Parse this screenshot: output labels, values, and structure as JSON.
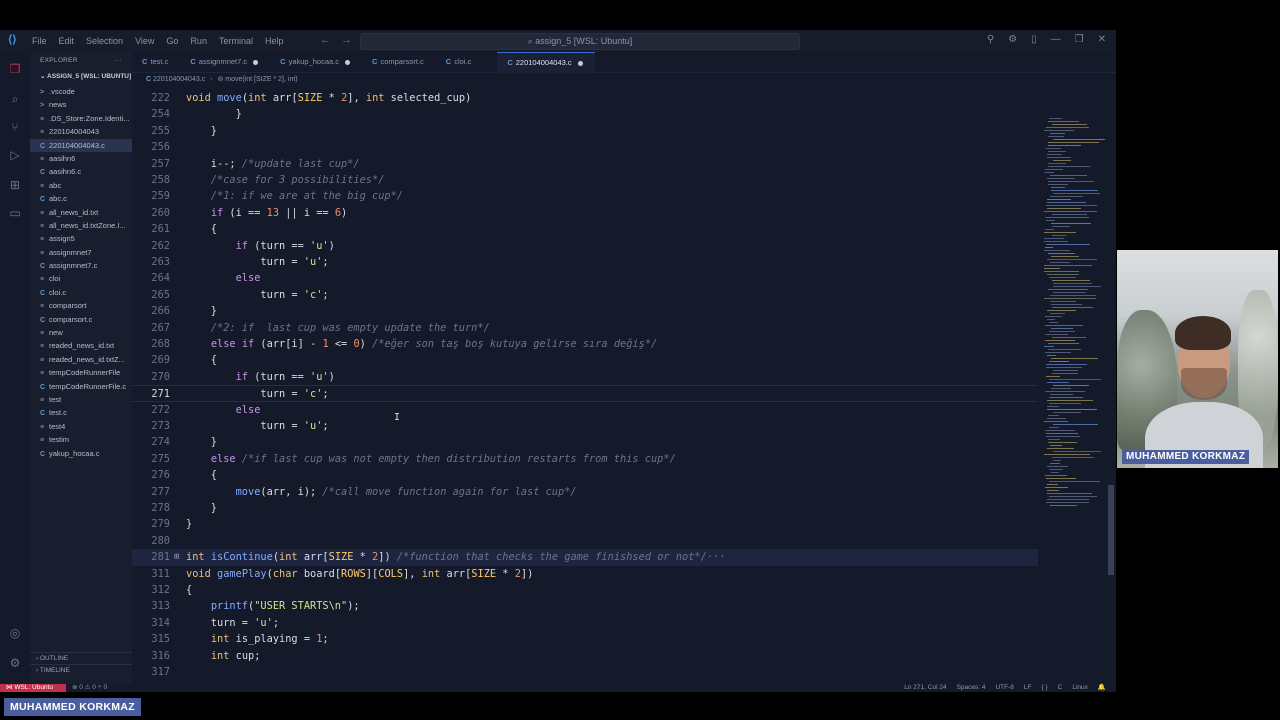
{
  "titlebar": {
    "menu": [
      "File",
      "Edit",
      "Selection",
      "View",
      "Go",
      "Run",
      "Terminal",
      "Help"
    ],
    "search": "assign_5 [WSL: Ubuntu]"
  },
  "sidebar": {
    "header": "EXPLORER",
    "header_more": "···",
    "folder": "ASSIGN_5 [WSL: UBUNTU]",
    "items": [
      {
        "label": ".vscode",
        "icon": ">"
      },
      {
        "label": "news",
        "icon": ">"
      },
      {
        "label": ".DS_Store:Zone.Identi...",
        "icon": "≡"
      },
      {
        "label": "220104004043",
        "icon": "≡"
      },
      {
        "label": "220104004043.c",
        "icon": "C"
      },
      {
        "label": "aasihn6",
        "icon": "≡"
      },
      {
        "label": "aasihn6.c",
        "icon": "C"
      },
      {
        "label": "abc",
        "icon": "≡"
      },
      {
        "label": "abc.c",
        "icon": "C"
      },
      {
        "label": "all_news_id.txt",
        "icon": "≡"
      },
      {
        "label": "all_news_id.txtZone.I...",
        "icon": "≡"
      },
      {
        "label": "assign5",
        "icon": "≡"
      },
      {
        "label": "assignmnet7",
        "icon": "≡"
      },
      {
        "label": "assignmnet7.c",
        "icon": "C"
      },
      {
        "label": "cloi",
        "icon": "≡"
      },
      {
        "label": "cloi.c",
        "icon": "C"
      },
      {
        "label": "comparsort",
        "icon": "≡"
      },
      {
        "label": "comparsort.c",
        "icon": "C"
      },
      {
        "label": "new",
        "icon": "≡"
      },
      {
        "label": "readed_news_id.txt",
        "icon": "≡"
      },
      {
        "label": "readed_news_id.txtZ...",
        "icon": "≡"
      },
      {
        "label": "tempCodeRunnerFile",
        "icon": "≡"
      },
      {
        "label": "tempCodeRunnerFile.c",
        "icon": "C"
      },
      {
        "label": "test",
        "icon": "≡"
      },
      {
        "label": "test.c",
        "icon": "C"
      },
      {
        "label": "test4",
        "icon": "≡"
      },
      {
        "label": "testim",
        "icon": "≡"
      },
      {
        "label": "yakup_hocaa.c",
        "icon": "C"
      }
    ],
    "outline": "OUTLINE",
    "timeline": "TIMELINE"
  },
  "tabs": [
    {
      "label": "test.c",
      "dirty": false
    },
    {
      "label": "assignmnet7.c",
      "dirty": true
    },
    {
      "label": "yakup_hocaa.c",
      "dirty": true
    },
    {
      "label": "comparsort.c",
      "dirty": false
    },
    {
      "label": "cloi.c",
      "dirty": false
    },
    {
      "label": "220104004043.c",
      "dirty": true,
      "active": true
    }
  ],
  "breadcrumb": {
    "file": "220104004043.c",
    "symbol": "move(int [SIZE * 2], int)"
  },
  "editor": {
    "lines": [
      {
        "n": "222",
        "t": "void move(int arr[SIZE * 2], int selected_cup)"
      },
      {
        "n": "254",
        "t": "        }"
      },
      {
        "n": "255",
        "t": "    }"
      },
      {
        "n": "256",
        "t": ""
      },
      {
        "n": "257",
        "t": "    i--; /*update last cup*/"
      },
      {
        "n": "258",
        "t": "    /*case for 3 possibilities*/"
      },
      {
        "n": "259",
        "t": "    /*1: if we are at the big cup*/"
      },
      {
        "n": "260",
        "t": "    if (i == 13 || i == 6)"
      },
      {
        "n": "261",
        "t": "    {"
      },
      {
        "n": "262",
        "t": "        if (turn == 'u')"
      },
      {
        "n": "263",
        "t": "            turn = 'u';"
      },
      {
        "n": "264",
        "t": "        else"
      },
      {
        "n": "265",
        "t": "            turn = 'c';"
      },
      {
        "n": "266",
        "t": "    }"
      },
      {
        "n": "267",
        "t": "    /*2: if  last cup was empty update the turn*/"
      },
      {
        "n": "268",
        "t": "    else if (arr[i] - 1 <= 0) /*eğer son taş boş kutuya gelirse sıra değiş*/"
      },
      {
        "n": "269",
        "t": "    {"
      },
      {
        "n": "270",
        "t": "        if (turn == 'u')"
      },
      {
        "n": "271",
        "t": "            turn = 'c';"
      },
      {
        "n": "272",
        "t": "        else"
      },
      {
        "n": "273",
        "t": "            turn = 'u';"
      },
      {
        "n": "274",
        "t": "    }"
      },
      {
        "n": "275",
        "t": "    else /*if last cup was not empty then distribution restarts from this cup*/"
      },
      {
        "n": "276",
        "t": "    {"
      },
      {
        "n": "277",
        "t": "        move(arr, i); /*call move function again for last cup*/"
      },
      {
        "n": "278",
        "t": "    }"
      },
      {
        "n": "279",
        "t": "}"
      },
      {
        "n": "280",
        "t": ""
      },
      {
        "n": "281",
        "t": "int isContinue(int arr[SIZE * 2]) /*function that checks the game finishsed or not*/···"
      },
      {
        "n": "311",
        "t": "void gamePlay(char board[ROWS][COLS], int arr[SIZE * 2])"
      },
      {
        "n": "312",
        "t": "{"
      },
      {
        "n": "313",
        "t": "    printf(\"USER STARTS\\n\");"
      },
      {
        "n": "314",
        "t": "    turn = 'u';"
      },
      {
        "n": "315",
        "t": "    int is_playing = 1;"
      },
      {
        "n": "316",
        "t": "    int cup;"
      },
      {
        "n": "317",
        "t": ""
      }
    ]
  },
  "statusbar": {
    "remote": "WSL: Ubuntu",
    "errors": "⊗ 0 ⚠ 0",
    "ports": "⑂ 0",
    "position": "Ln 271, Col 24",
    "spaces": "Spaces: 4",
    "encoding": "UTF-8",
    "eol": "LF",
    "braces": "{ }",
    "language": "C",
    "os": "Linux",
    "bell": "🔔"
  },
  "webcam": {
    "name": "MUHAMMED KORKMAZ"
  },
  "overlay": {
    "name": "MUHAMMED KORKMAZ"
  },
  "colors": {
    "accent": "#3b6fd4",
    "remote": "#c0304a",
    "name_tag": "#4a5d9c"
  }
}
